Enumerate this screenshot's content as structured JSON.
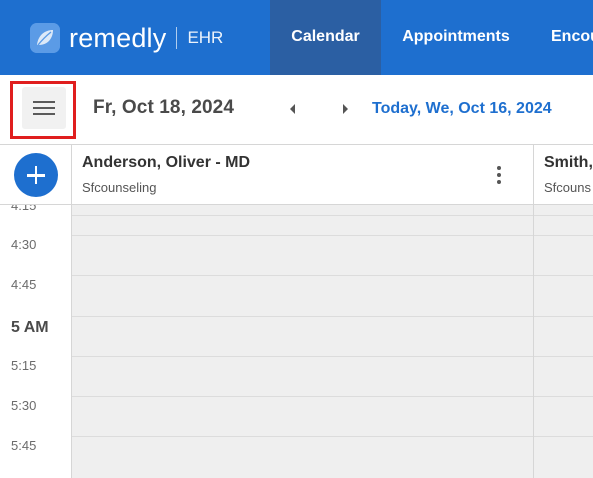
{
  "brand": {
    "name": "remedly",
    "product": "EHR"
  },
  "nav": {
    "tabs": [
      {
        "label": "Calendar",
        "active": true
      },
      {
        "label": "Appointments",
        "active": false
      },
      {
        "label": "Encou",
        "active": false
      }
    ]
  },
  "toolbar": {
    "menu_icon": "hamburger-menu-icon",
    "current_date": "Fr, Oct 18, 2024",
    "prev_icon": "caret-left-icon",
    "next_icon": "caret-right-icon",
    "today_label": "Today, We, Oct 16, 2024"
  },
  "providers": [
    {
      "name": "Anderson, Oliver - MD",
      "subtitle": "Sfcounseling"
    },
    {
      "name": "Smith,",
      "subtitle": "Sfcouns"
    }
  ],
  "time_slots": [
    {
      "label": "4:15",
      "hour": false
    },
    {
      "label": "4:30",
      "hour": false
    },
    {
      "label": "4:45",
      "hour": false
    },
    {
      "label": "5 AM",
      "hour": true
    },
    {
      "label": "5:15",
      "hour": false
    },
    {
      "label": "5:30",
      "hour": false
    },
    {
      "label": "5:45",
      "hour": false
    }
  ],
  "colors": {
    "brand_blue": "#1e6fcf",
    "active_tab": "#2b5fa3",
    "highlight": "#e01e1e",
    "slot_bg": "#efefef"
  }
}
